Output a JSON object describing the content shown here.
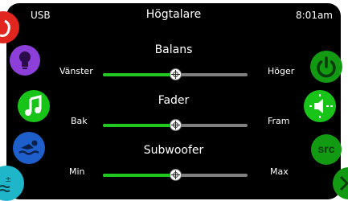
{
  "header": {
    "source_label": "USB",
    "title": "Högtalare",
    "clock": "8:01am"
  },
  "sliders": [
    {
      "label": "Balans",
      "left_label": "Vänster",
      "right_label": "Höger",
      "value": 0.5
    },
    {
      "label": "Fader",
      "left_label": "Bak",
      "right_label": "Fram",
      "value": 0.5
    },
    {
      "label": "Subwoofer",
      "left_label": "Min",
      "right_label": "Max",
      "value": 0.5
    }
  ],
  "right_buttons": {
    "source_label": "src"
  },
  "colors": {
    "background": "#000000",
    "accent_green": "#1fc71f",
    "track_gray": "#7f7f7f",
    "text": "#ffffff"
  },
  "icons": {
    "left": [
      "red-partial-icon",
      "lightbulb-icon",
      "music-note-icon",
      "swimmer-icon",
      "water-temperature-icon"
    ],
    "right": [
      "power-icon",
      "speaker-icon",
      "src-icon",
      "chevron-right-icon"
    ]
  }
}
